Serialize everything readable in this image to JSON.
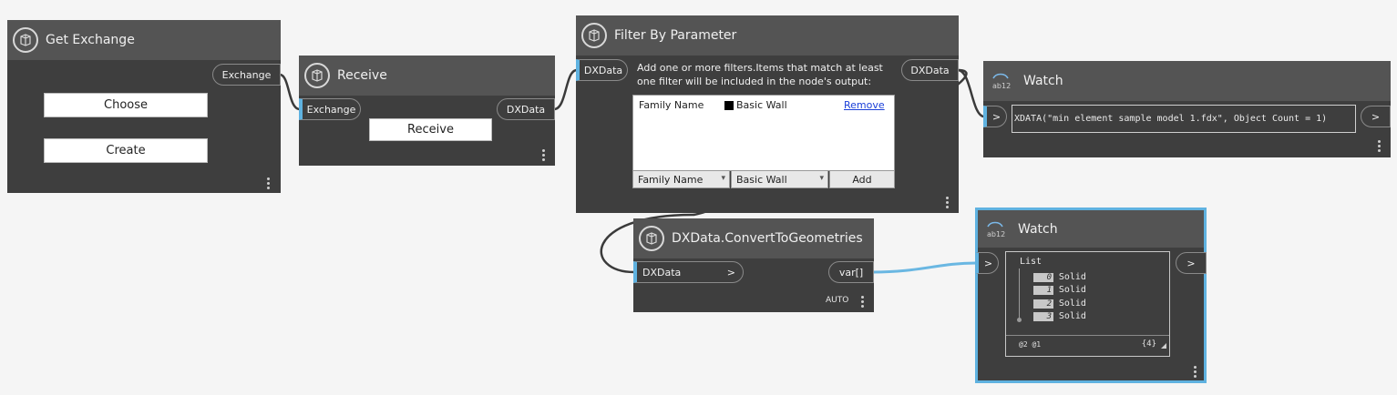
{
  "nodes": {
    "get_exchange": {
      "title": "Get Exchange",
      "output": "Exchange",
      "choose_label": "Choose",
      "create_label": "Create"
    },
    "receive": {
      "title": "Receive",
      "input": "Exchange",
      "output": "DXData",
      "button_label": "Receive"
    },
    "filter": {
      "title": "Filter By Parameter",
      "input": "DXData",
      "output": "DXData",
      "description": "Add one or more filters.Items that match at least one filter will be included in the node's output:",
      "rows": [
        {
          "param": "Family Name",
          "value": "Basic Wall",
          "remove_label": "Remove"
        }
      ],
      "param_select": "Family Name",
      "value_select": "Basic Wall",
      "add_label": "Add"
    },
    "watch1": {
      "title": "Watch",
      "input": ">",
      "output": ">",
      "value": "XDATA(\"min element sample model 1.fdx\", Object Count = 1)"
    },
    "convert": {
      "title": "DXData.ConvertToGeometries",
      "input": "DXData",
      "input_arrow": ">",
      "output": "var[]",
      "lacing": "AUTO"
    },
    "watch2": {
      "title": "Watch",
      "input": ">",
      "output": ">",
      "list_label": "List",
      "items": [
        {
          "index": "0",
          "value": "Solid"
        },
        {
          "index": "1",
          "value": "Solid"
        },
        {
          "index": "2",
          "value": "Solid"
        },
        {
          "index": "3",
          "value": "Solid"
        }
      ],
      "levels": "@2 @1",
      "count": "{4}"
    }
  },
  "colors": {
    "canvas": "#f5f5f5",
    "node_body": "#3e3e3e",
    "node_header": "#545454",
    "port_accent": "#5fb2e0",
    "selected_border": "#5fb2e0",
    "wire_dark": "#3a3a3a",
    "wire_blue": "#6ab7e2"
  },
  "icons": {
    "node": "dynamo-node-icon",
    "watch": "watch-ab12-icon"
  }
}
